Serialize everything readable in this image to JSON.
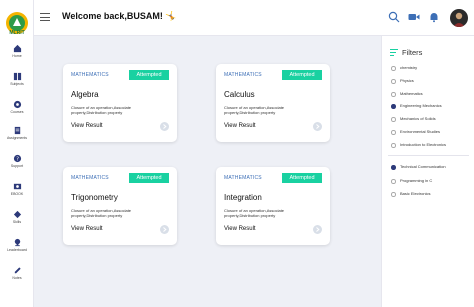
{
  "brand": {
    "name": "MLRIT"
  },
  "nav": [
    {
      "id": "home",
      "label": "Home"
    },
    {
      "id": "subjects",
      "label": "Subjects"
    },
    {
      "id": "courses",
      "label": "Courses"
    },
    {
      "id": "assignments",
      "label": "Assignments"
    },
    {
      "id": "support",
      "label": "Support"
    },
    {
      "id": "ebook",
      "label": "EBOOK"
    },
    {
      "id": "skills",
      "label": "Skills"
    },
    {
      "id": "leaderboard",
      "label": "Leaderboard"
    },
    {
      "id": "notes",
      "label": "Notes"
    }
  ],
  "header": {
    "welcome": "Welcome back,BUSAM! 🤸"
  },
  "cards": [
    {
      "subject": "MATHEMATICS",
      "status": "Attempted",
      "title": "Algebra",
      "description": "Closure of an operation,Associate property,Distribution property",
      "action": "View Result"
    },
    {
      "subject": "MATHEMATICS",
      "status": "Attempted",
      "title": "Calculus",
      "description": "Closure of an operation,Associate property,Distribution property",
      "action": "View Result"
    },
    {
      "subject": "MATHEMATICS",
      "status": "Attempted",
      "title": "Trigonometry",
      "description": "Closure of an operation,Associate property,Distribution property",
      "action": "View Result"
    },
    {
      "subject": "MATHEMATICS",
      "status": "Attempted",
      "title": "Integration",
      "description": "Closure of an operation,Associate property,Distribution property",
      "action": "View Result"
    }
  ],
  "filters": {
    "title": "Filters",
    "group1": [
      {
        "label": "chemistry",
        "selected": false
      },
      {
        "label": "Physics",
        "selected": false
      },
      {
        "label": "Mathematics",
        "selected": false
      },
      {
        "label": "Engineering Mechanics",
        "selected": true
      },
      {
        "label": "Mechanics of Solids",
        "selected": false
      },
      {
        "label": "Environmental Studies",
        "selected": false
      },
      {
        "label": "Introduction to Electronics",
        "selected": false
      }
    ],
    "group2": [
      {
        "label": "Technical Communication",
        "selected": true
      },
      {
        "label": "Programming in C",
        "selected": false
      },
      {
        "label": "Basic Electronics",
        "selected": false
      }
    ]
  },
  "colors": {
    "accent": "#19d1a1",
    "subject": "#3d6fb6",
    "background": "#eef0f6",
    "primary": "#2d3a7a"
  }
}
